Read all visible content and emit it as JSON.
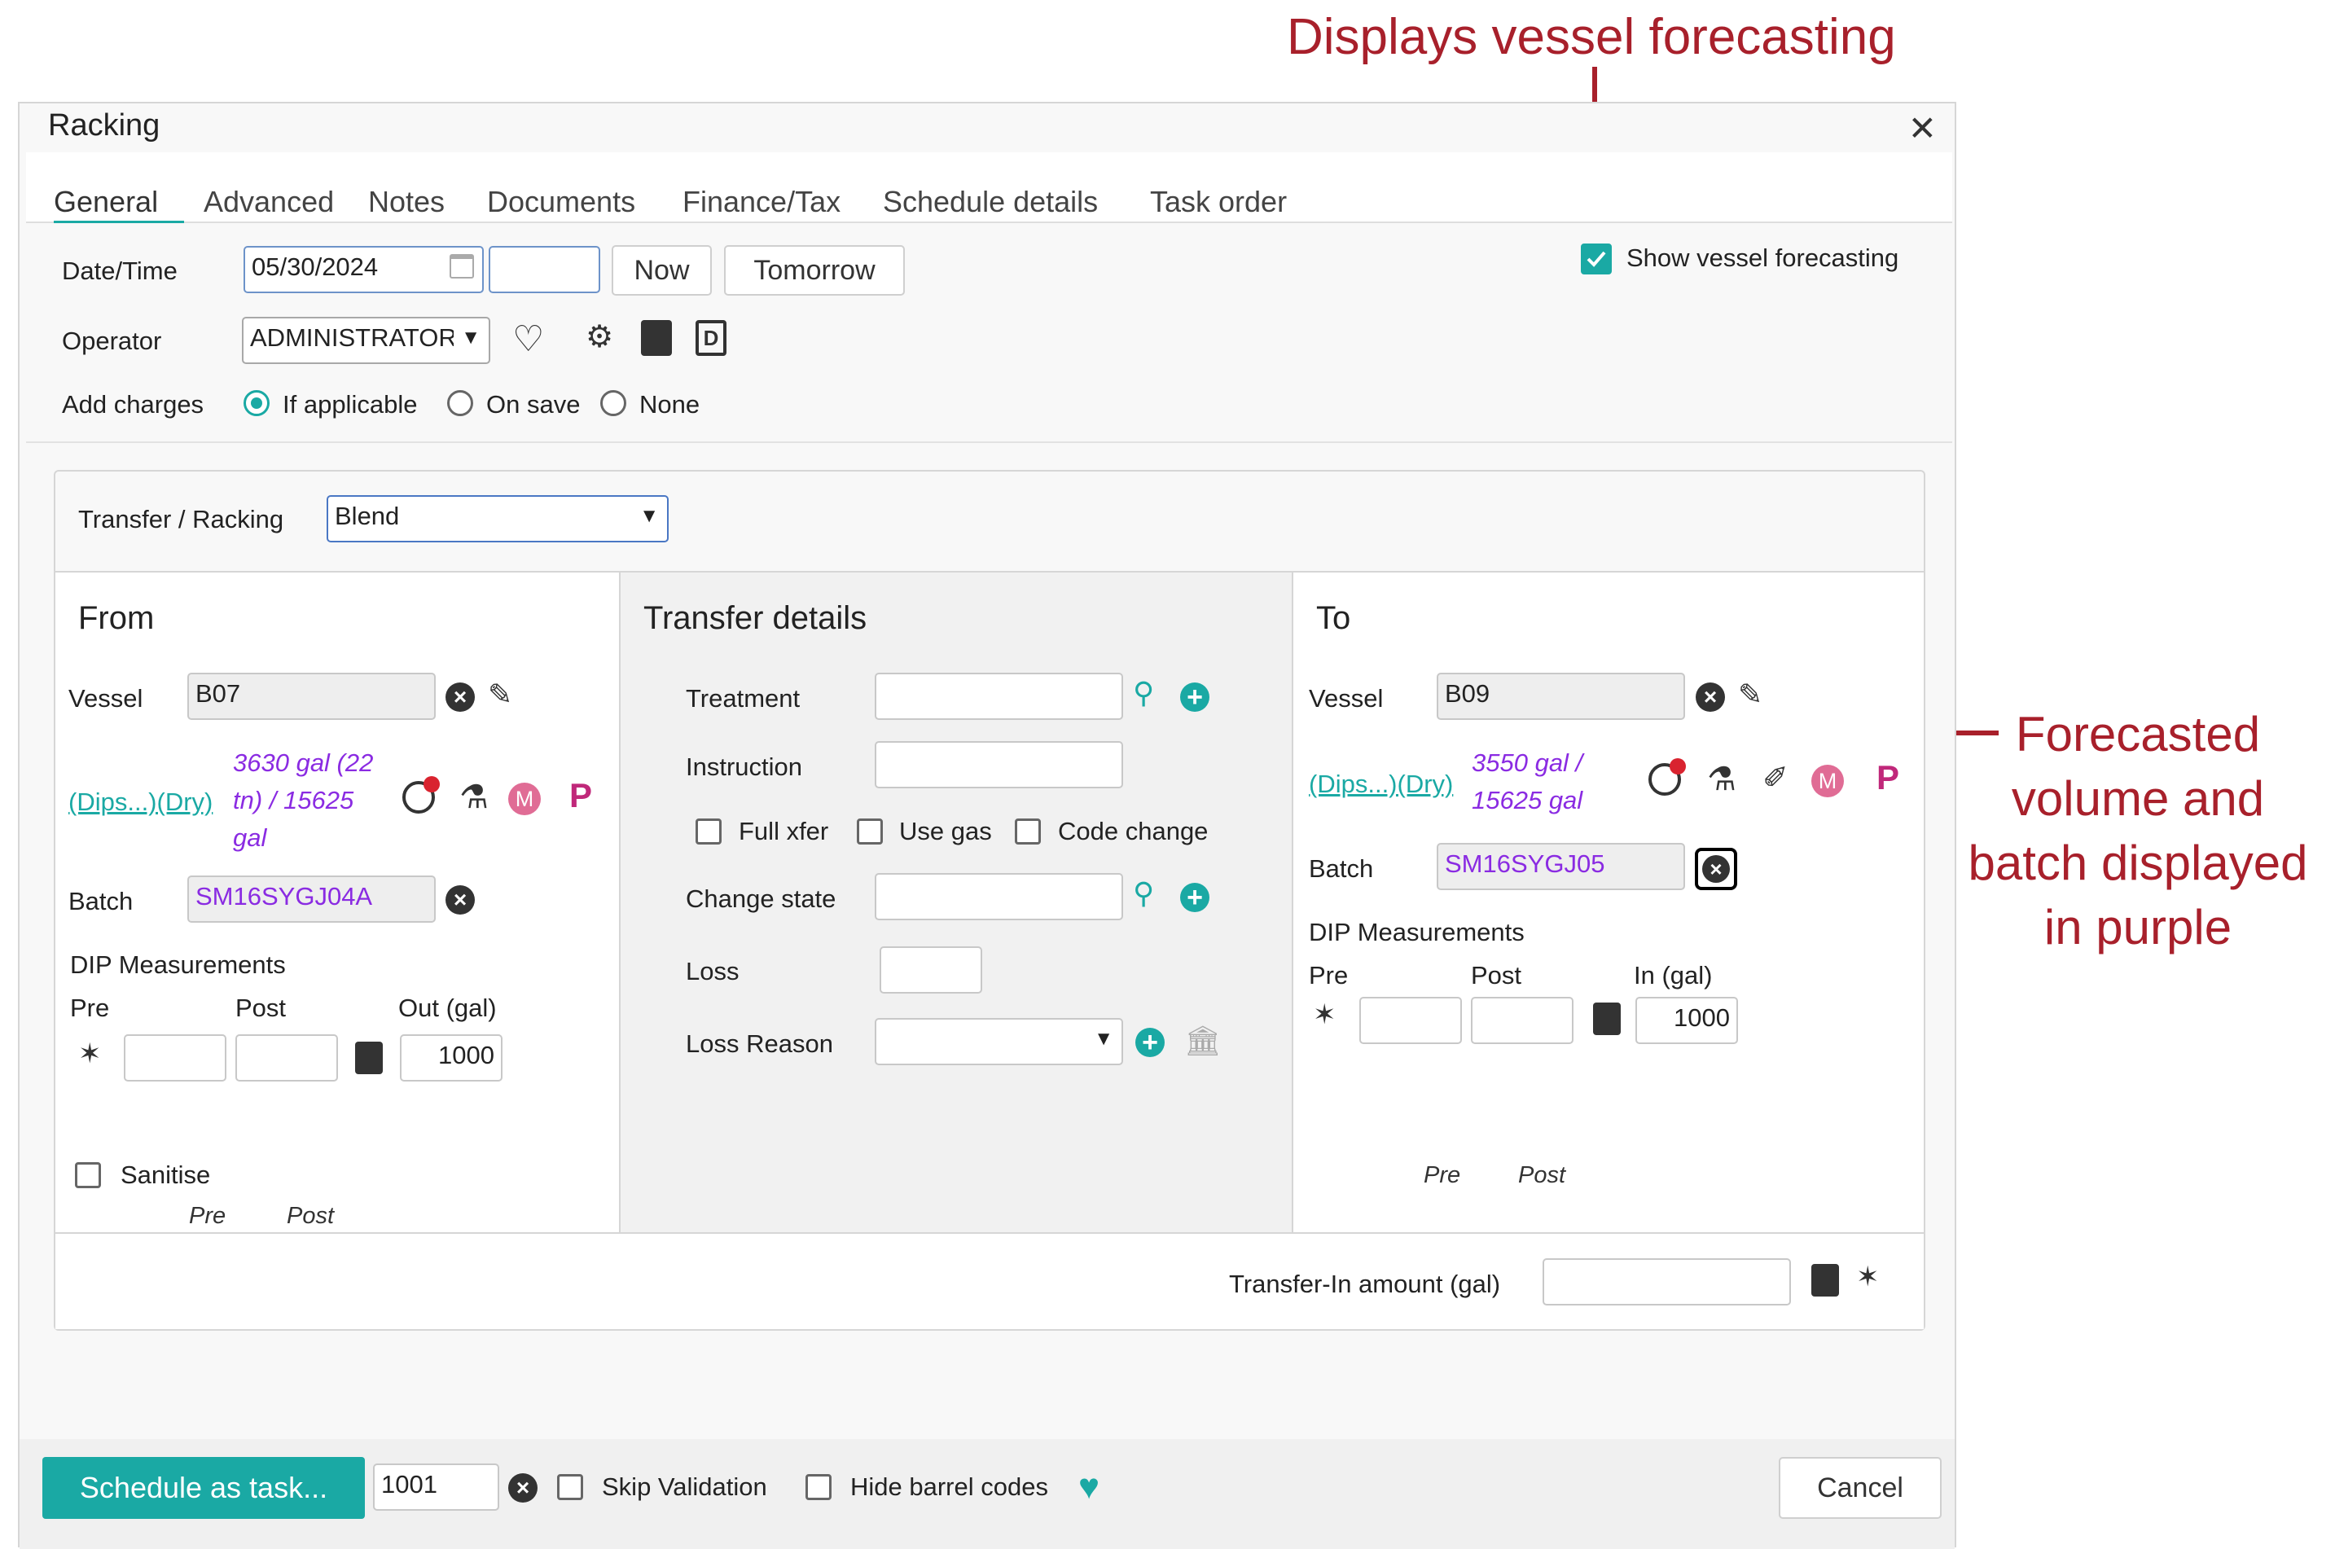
{
  "annotations": {
    "top": "Displays vessel forecasting",
    "right_lines": [
      "Forecasted",
      "volume and",
      "batch displayed",
      "in purple"
    ]
  },
  "dialog": {
    "title": "Racking",
    "close": "✕",
    "tabs": [
      "General",
      "Advanced",
      "Notes",
      "Documents",
      "Finance/Tax",
      "Schedule details",
      "Task order"
    ],
    "active_tab": "General"
  },
  "general": {
    "datetime_label": "Date/Time",
    "date_value": "05/30/2024",
    "time_value": "",
    "now_label": "Now",
    "tomorrow_label": "Tomorrow",
    "operator_label": "Operator",
    "operator_value": "ADMINISTRATOR",
    "add_charges_label": "Add charges",
    "charge_options": [
      "If applicable",
      "On save",
      "None"
    ],
    "charge_selected": "If applicable",
    "show_forecast_label": "Show vessel forecasting",
    "show_forecast_checked": true
  },
  "transfer": {
    "type_label": "Transfer / Racking",
    "type_value": "Blend",
    "from": {
      "header": "From",
      "vessel_label": "Vessel",
      "vessel_value": "B07",
      "dips_link": "(Dips...)(Dry)",
      "forecast_lines": [
        "3630 gal (22",
        "tn) / 15625",
        "gal"
      ],
      "batch_label": "Batch",
      "batch_value": "SM16SYGJ04A",
      "dip_title": "DIP Measurements",
      "pre_label": "Pre",
      "post_label": "Post",
      "out_label": "Out (gal)",
      "out_value": "1000",
      "pre_hint": "Pre",
      "post_hint": "Post",
      "sanitise_label": "Sanitise",
      "m_icon": "M",
      "p_icon": "P"
    },
    "details": {
      "header": "Transfer details",
      "treatment_label": "Treatment",
      "instruction_label": "Instruction",
      "full_xfer_label": "Full xfer",
      "use_gas_label": "Use gas",
      "code_change_label": "Code change",
      "change_state_label": "Change state",
      "loss_label": "Loss",
      "loss_reason_label": "Loss Reason"
    },
    "to": {
      "header": "To",
      "vessel_label": "Vessel",
      "vessel_value": "B09",
      "dips_link": "(Dips...)(Dry)",
      "forecast_lines": [
        "3550 gal /",
        "15625 gal"
      ],
      "batch_label": "Batch",
      "batch_value": "SM16SYGJ05",
      "dip_title": "DIP Measurements",
      "pre_label": "Pre",
      "post_label": "Post",
      "in_label": "In (gal)",
      "in_value": "1000",
      "pre_hint": "Pre",
      "post_hint": "Post",
      "m_icon": "M",
      "p_icon": "P"
    },
    "transfer_in_label": "Transfer-In amount (gal)",
    "transfer_in_value": ""
  },
  "footer": {
    "schedule_label": "Schedule as task...",
    "task_number": "1001",
    "skip_validation_label": "Skip Validation",
    "hide_barrel_label": "Hide barrel codes",
    "cancel_label": "Cancel"
  },
  "colors": {
    "accent": "#1aa9a4",
    "annotation": "#a8202b",
    "forecast_purple": "#8a2be2"
  }
}
